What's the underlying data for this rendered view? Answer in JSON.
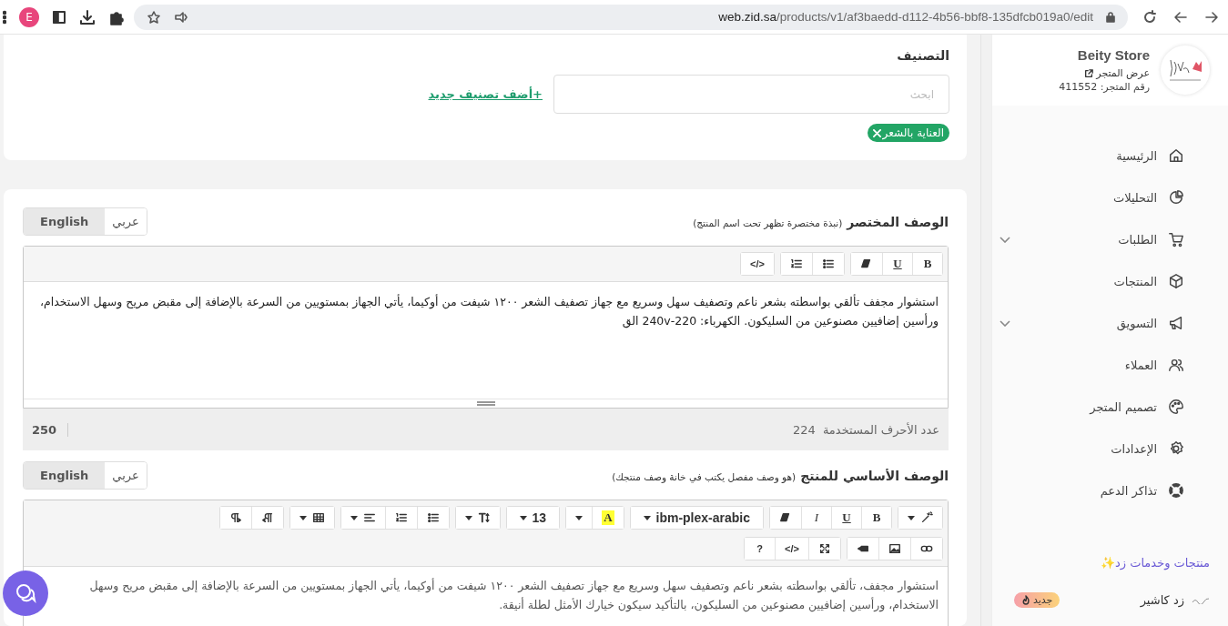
{
  "browser": {
    "profile_initial": "E",
    "url_host": "web.zid.sa",
    "url_path": "/products/v1/af3baedd-d112-4b56-bbf8-135dfcb019a0/edit"
  },
  "category": {
    "title": "التصنيف",
    "search_placeholder": "ابحث",
    "add_link": "+أضف تصنيف جديد",
    "tags": [
      {
        "label": "العناية بالشعر"
      }
    ]
  },
  "short_description": {
    "title": "الوصف المختصر",
    "hint": "(نبذة مختصرة تظهر تحت اسم المنتج)",
    "languages": [
      {
        "label": "عربي",
        "selected": false
      },
      {
        "label": "English",
        "selected": true
      }
    ],
    "toolbar": [
      [
        [
          {
            "kind": "bold",
            "text": "B"
          },
          {
            "kind": "underline",
            "text": "U"
          },
          {
            "kind": "eraser"
          }
        ],
        [
          {
            "kind": "bullets"
          },
          {
            "kind": "numbers"
          }
        ],
        [
          {
            "kind": "label",
            "text": "</>"
          }
        ]
      ]
    ],
    "text": "استشوار مجفف تألقي بواسطته بشعر ناعم وتصفيف سهل وسريع مع جهاز تصفيف الشعر ١٢٠٠ شيفت من أوكيما، يأتي الجهاز بمستويين من السرعة بالإضافة إلى مقبض مريح وسهل الاستخدام، ورأسين إضافيين مصنوعين من السليكون. الكهرباء: 220-240v الق",
    "counter": {
      "label": "عدد الأحرف المستخدمة",
      "used": "224",
      "limit": "250"
    }
  },
  "main_description": {
    "title": "الوصف الأساسي للمنتج",
    "hint": "(هو وصف مفصل يكتب في خانة وصف منتجك)",
    "languages": [
      {
        "label": "عربي",
        "selected": false
      },
      {
        "label": "English",
        "selected": true
      }
    ],
    "toolbar": [
      [
        [
          {
            "kind": "magic",
            "caret": true
          }
        ],
        [
          {
            "kind": "bold",
            "text": "B"
          },
          {
            "kind": "underline",
            "text": "U"
          },
          {
            "kind": "italic",
            "text": "I"
          },
          {
            "kind": "eraser"
          }
        ],
        [
          {
            "kind": "dropdown",
            "text": "ibm-plex-arabic",
            "caret": true
          }
        ],
        [
          {
            "kind": "highlight",
            "text": "A"
          },
          {
            "kind": "caret"
          }
        ],
        [
          {
            "kind": "dropdown",
            "text": "13",
            "caret": true
          }
        ],
        [
          {
            "kind": "textsize",
            "caret": true
          }
        ],
        [
          {
            "kind": "bullets"
          },
          {
            "kind": "numbers"
          },
          {
            "kind": "align",
            "caret": true
          }
        ],
        [
          {
            "kind": "table",
            "caret": true
          }
        ],
        [
          {
            "kind": "rtl"
          },
          {
            "kind": "ltr"
          }
        ]
      ],
      [
        [
          {
            "kind": "link"
          },
          {
            "kind": "image"
          },
          {
            "kind": "video"
          }
        ],
        [
          {
            "kind": "fullscreen"
          },
          {
            "kind": "label",
            "text": "</>"
          },
          {
            "kind": "label",
            "text": "?"
          }
        ]
      ]
    ],
    "text": "استشوار مجفف، تألقي بواسطته بشعر ناعم وتصفيف سهل وسريع مع جهاز تصفيف الشعر ١٢٠٠ شيفت من أوكيما، يأتي الجهاز بمستويين من السرعة بالإضافة إلى مقبض مريح وسهل الاستخدام، ورأسين إضافيين مصنوعين من السليكون، بالتأكيد سيكون خيارك الأمثل لطلة أنيقة."
  },
  "sidebar": {
    "store_name": "Beity Store",
    "view_store": "عرض المتجر",
    "store_number": "رقم المتجر: 411552",
    "items": [
      {
        "label": "الرئيسية",
        "kind": "home",
        "has_submenu": false
      },
      {
        "label": "التحليلات",
        "kind": "chart",
        "has_submenu": false
      },
      {
        "label": "الطلبات",
        "kind": "cart",
        "has_submenu": true
      },
      {
        "label": "المنتجات",
        "kind": "box",
        "has_submenu": false
      },
      {
        "label": "التسويق",
        "kind": "megaphone",
        "has_submenu": true
      },
      {
        "label": "العملاء",
        "kind": "users",
        "has_submenu": false
      },
      {
        "label": "تصميم المتجر",
        "kind": "palette",
        "has_submenu": false
      },
      {
        "label": "الإعدادات",
        "kind": "gear",
        "has_submenu": false
      },
      {
        "label": "تذاكر الدعم",
        "kind": "lifebuoy",
        "has_submenu": false
      }
    ],
    "services_title": "منتجات وخدمات زد✨",
    "services": [
      {
        "label": "زد كاشير",
        "badge": "جديد"
      }
    ]
  }
}
